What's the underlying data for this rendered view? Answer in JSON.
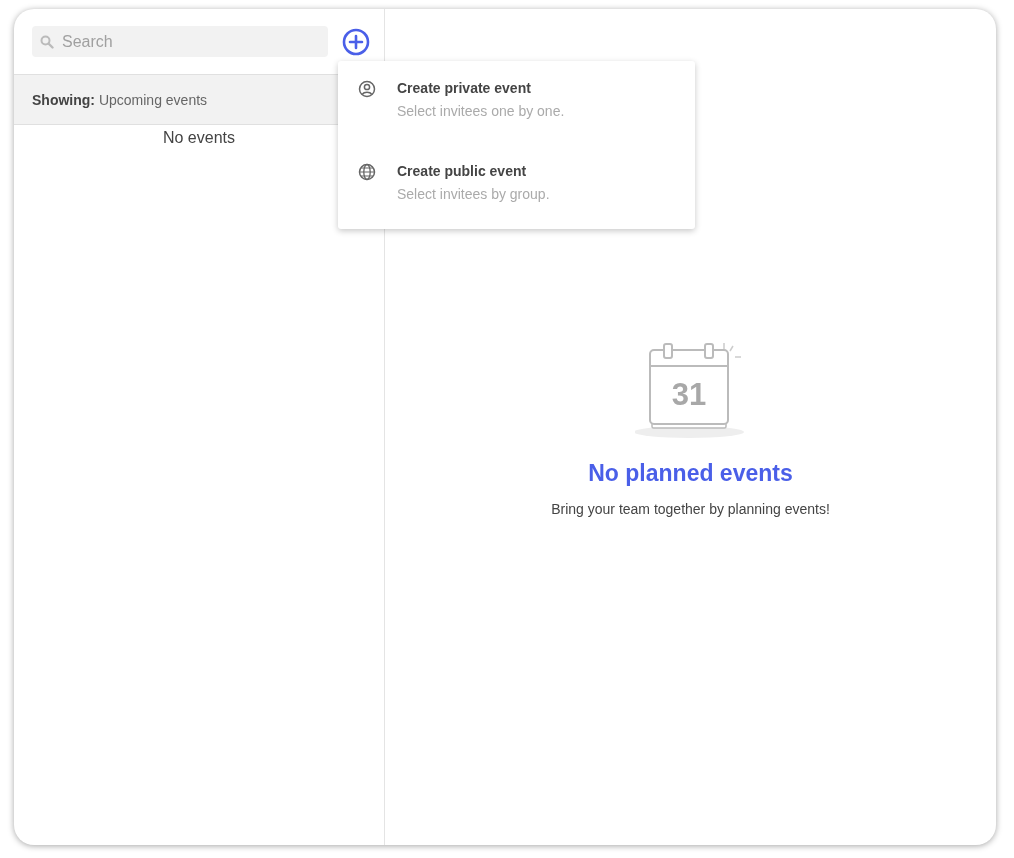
{
  "search": {
    "placeholder": "Search"
  },
  "filter": {
    "label": "Showing:",
    "value": "Upcoming events"
  },
  "list_empty": "No events",
  "menu": [
    {
      "kind": "private",
      "title": "Create private event",
      "subtitle": "Select invitees one by one."
    },
    {
      "kind": "public",
      "title": "Create public event",
      "subtitle": "Select invitees by group."
    }
  ],
  "empty_state": {
    "calendar_day": "31",
    "title": "No planned events",
    "message": "Bring your team together by planning events!"
  }
}
